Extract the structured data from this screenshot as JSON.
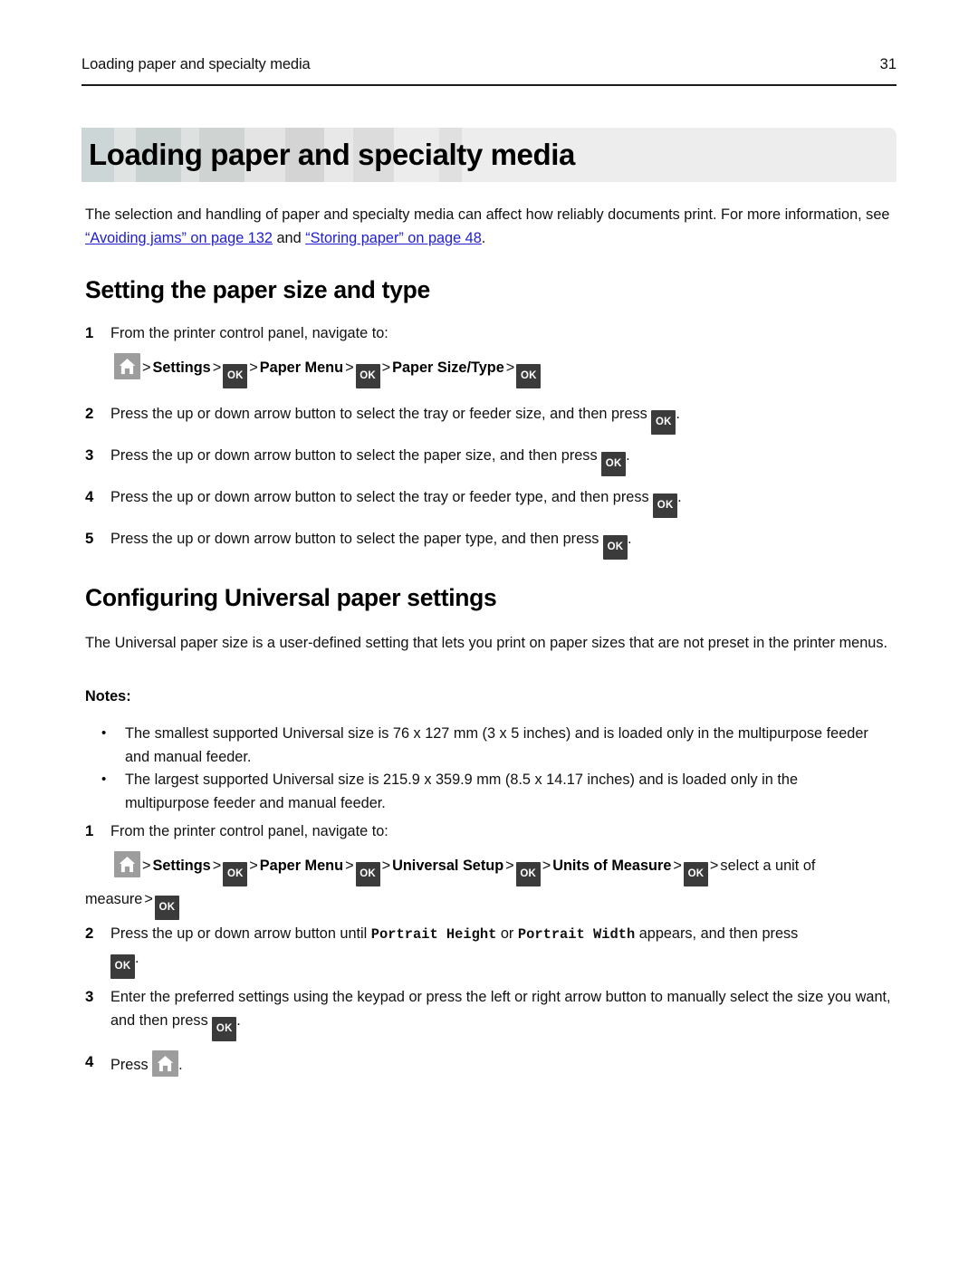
{
  "header": {
    "title": "Loading paper and specialty media",
    "page_number": "31"
  },
  "chapter": {
    "title": "Loading paper and specialty media"
  },
  "intro": {
    "text_before_link1": "The selection and handling of paper and specialty media can affect how reliably documents print. For more information, see ",
    "link1": "“Avoiding jams” on page 132",
    "text_between": " and ",
    "link2": "“Storing paper” on page 48",
    "text_after": "."
  },
  "section1": {
    "heading": "Setting the paper size and type",
    "steps": [
      {
        "number": "1",
        "text": "From the printer control panel, navigate to:"
      },
      {
        "number": "2",
        "text_before": "Press the up or down arrow button to select the tray or feeder size, and then press ",
        "key": "OK",
        "text_after": "."
      },
      {
        "number": "3",
        "text_before": "Press the up or down arrow button to select the paper size, and then press ",
        "key": "OK",
        "text_after": "."
      },
      {
        "number": "4",
        "text_before": "Press the up or down arrow button to select the tray or feeder type, and then press ",
        "key": "OK",
        "text_after": "."
      },
      {
        "number": "5",
        "text_before": "Press the up or down arrow button to select the paper type, and then press ",
        "key": "OK",
        "text_after": "."
      }
    ],
    "navpath": {
      "home_icon": "home-icon",
      "sep": ">",
      "item1": "Settings",
      "key1": "OK",
      "item2": "Paper Menu",
      "key2": "OK",
      "item3": "Paper Size/Type",
      "key3": "OK"
    }
  },
  "section2": {
    "heading": "Configuring Universal paper settings",
    "intro": "The Universal paper size is a user-defined setting that lets you print on paper sizes that are not preset in the printer menus.",
    "notes_label": "Notes:",
    "notes": [
      "The smallest supported Universal size is 76 x 127 mm (3 x 5 inches) and is loaded only in the multipurpose feeder and manual feeder.",
      "The largest supported Universal size is 215.9 x 359.9 mm (8.5 x 14.17 inches) and is loaded only in the multipurpose feeder and manual feeder."
    ],
    "bullet_glyph": "•",
    "steps": [
      {
        "number": "1",
        "text": "From the printer control panel, navigate to:"
      },
      {
        "number": "2",
        "text_before": "Press the up or down arrow button until ",
        "mono1": "Portrait Height",
        "text_mid": " or ",
        "mono2": "Portrait Width",
        "text_after": " appears, and then press ",
        "key": "OK",
        "text_end": "."
      },
      {
        "number": "3",
        "text_before": "Enter the preferred settings using the keypad or press the left or right arrow button to manually select the size you want, and then press ",
        "key": "OK",
        "text_after": "."
      },
      {
        "number": "4",
        "text_before": "Press ",
        "text_after": "."
      }
    ],
    "navpath": {
      "home_icon": "home-icon",
      "sep": ">",
      "item1": "Settings",
      "key1": "OK",
      "item2": "Paper Menu",
      "key2": "OK",
      "item3": "Universal Setup",
      "key3": "OK",
      "item4": "Units of Measure",
      "key4": "OK",
      "tail": "select a unit of measure",
      "key5": "OK"
    }
  },
  "colors": {
    "link": "#2020d0",
    "key_bg": "#3b3b3b",
    "home_bg": "#9d9d9d",
    "banner_right": "#ededed"
  }
}
